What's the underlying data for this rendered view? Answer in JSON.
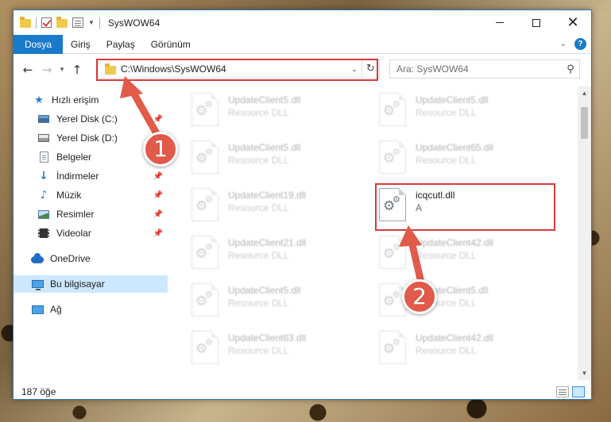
{
  "window": {
    "title": "SysWOW64",
    "controls": {
      "minimize": "—",
      "maximize": "□",
      "close": "✕"
    }
  },
  "ribbon": {
    "tabs": [
      {
        "label": "Dosya",
        "active": true
      },
      {
        "label": "Giriş"
      },
      {
        "label": "Paylaş"
      },
      {
        "label": "Görünüm"
      }
    ],
    "help": "?"
  },
  "nav": {
    "address": "C:\\Windows\\SysWOW64",
    "search_placeholder": "Ara: SysWOW64"
  },
  "sidebar": {
    "items": [
      {
        "label": "Hızlı erişim",
        "icon": "star-icon"
      },
      {
        "label": "Yerel Disk (C:)",
        "icon": "drive-icon",
        "pinned": true
      },
      {
        "label": "Yerel Disk (D:)",
        "icon": "drive-icon"
      },
      {
        "label": "Belgeler",
        "icon": "documents-icon"
      },
      {
        "label": "İndirmeler",
        "icon": "download-icon",
        "pinned": true
      },
      {
        "label": "Müzik",
        "icon": "music-icon",
        "pinned": true
      },
      {
        "label": "Resimler",
        "icon": "pictures-icon",
        "pinned": true
      },
      {
        "label": "Videolar",
        "icon": "videos-icon",
        "pinned": true
      },
      {
        "label": "OneDrive",
        "icon": "cloud-icon"
      },
      {
        "label": "Bu bilgisayar",
        "icon": "computer-icon",
        "selected": true
      },
      {
        "label": "Ağ",
        "icon": "network-icon"
      }
    ]
  },
  "files": [
    {
      "name": "UpdateClient5.dll",
      "desc": "Resource DLL"
    },
    {
      "name": "UpdateClient5.dll",
      "desc": "Resource DLL"
    },
    {
      "name": "UpdateClient5.dll",
      "desc": "Resource DLL"
    },
    {
      "name": "UpdateClient65.dll",
      "desc": "Resource DLL"
    },
    {
      "name": "UpdateClient19.dll",
      "desc": "Resource DLL"
    },
    {
      "name": "icqcutl.dll",
      "desc": "A",
      "highlighted": true
    },
    {
      "name": "UpdateClient21.dll",
      "desc": "Resource DLL"
    },
    {
      "name": "UpdateClient42.dll",
      "desc": "Resource DLL"
    },
    {
      "name": "UpdateClient5.dll",
      "desc": "Resource DLL"
    },
    {
      "name": "UpdateClient5.dll",
      "desc": "Resource DLL"
    },
    {
      "name": "UpdateClient63.dll",
      "desc": "Resource DLL"
    },
    {
      "name": "UpdateClient42.dll",
      "desc": "Resource DLL"
    }
  ],
  "status": {
    "item_count": "187 öğe"
  },
  "callouts": [
    {
      "number": "1",
      "target": "address-bar"
    },
    {
      "number": "2",
      "target": "icqcutl.dll"
    }
  ],
  "colors": {
    "accent": "#1979ca",
    "highlight_box": "#d63b3b",
    "badge": "#e15a4a",
    "selected_bg": "#cce8ff"
  }
}
